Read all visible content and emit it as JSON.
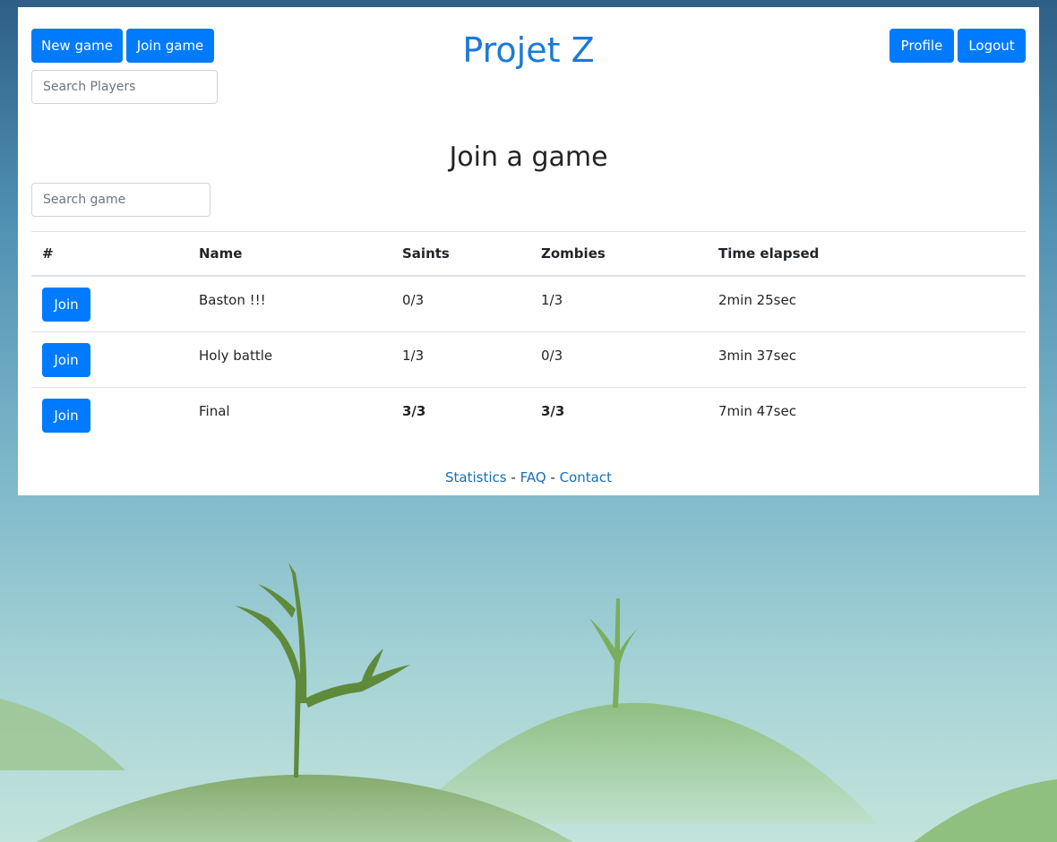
{
  "header": {
    "new_game_label": "New game",
    "join_game_label": "Join game",
    "search_players_placeholder": "Search Players",
    "brand": "Projet Z",
    "profile_label": "Profile",
    "logout_label": "Logout"
  },
  "main": {
    "title": "Join a game",
    "search_game_placeholder": "Search game",
    "table": {
      "columns": [
        "#",
        "Name",
        "Saints",
        "Zombies",
        "Time elapsed"
      ],
      "rows": [
        {
          "action": "Join",
          "name": "Baston !!!",
          "saints": "0/3",
          "zombies": "1/3",
          "time": "2min 25sec"
        },
        {
          "action": "Join",
          "name": "Holy battle",
          "saints": "1/3",
          "zombies": "0/3",
          "time": "3min 37sec"
        },
        {
          "action": "Join",
          "name": "Final",
          "saints": "3/3",
          "zombies": "3/3",
          "time": "7min 47sec"
        }
      ]
    }
  },
  "footer": {
    "links": [
      "Statistics",
      "FAQ",
      "Contact"
    ],
    "separator": "-"
  },
  "colors": {
    "primary": "#007bff",
    "brand": "#1a7ad8",
    "link": "#1a6fb8"
  }
}
